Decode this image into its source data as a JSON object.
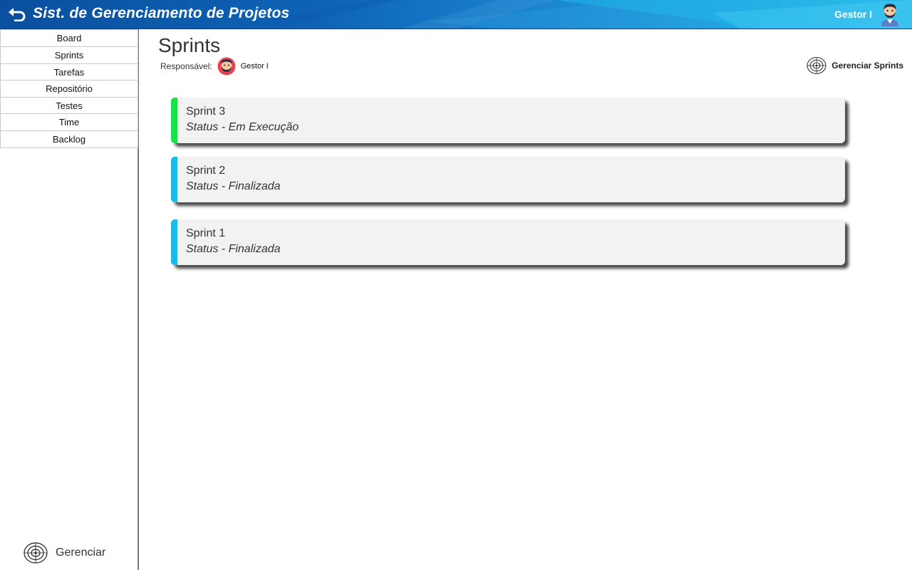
{
  "header": {
    "title": "Sist. de Gerenciamento de Projetos",
    "user_name": "Gestor I",
    "back_icon": "back-arrow-icon",
    "colors": {
      "gradient_start": "#0a4f9e",
      "gradient_end": "#3ec1ee"
    }
  },
  "sidebar": {
    "items": [
      {
        "label": "Board"
      },
      {
        "label": "Sprints"
      },
      {
        "label": "Tarefas"
      },
      {
        "label": "Repositório"
      },
      {
        "label": "Testes"
      },
      {
        "label": "Time"
      },
      {
        "label": "Backlog"
      }
    ],
    "footer": {
      "label": "Gerenciar",
      "icon": "target-icon"
    }
  },
  "main": {
    "title": "Sprints",
    "responsavel_label": "Responsável:",
    "responsavel_name": "Gestor I",
    "manage_label": "Gerenciar Sprints",
    "sprints": [
      {
        "name": "Sprint 3",
        "status": "Status - Em Execução",
        "color": "#17e24a"
      },
      {
        "name": "Sprint 2",
        "status": "Status - Finalizada",
        "color": "#19bbe8"
      },
      {
        "name": "Sprint 1",
        "status": "Status - Finalizada",
        "color": "#19bbe8"
      }
    ]
  }
}
